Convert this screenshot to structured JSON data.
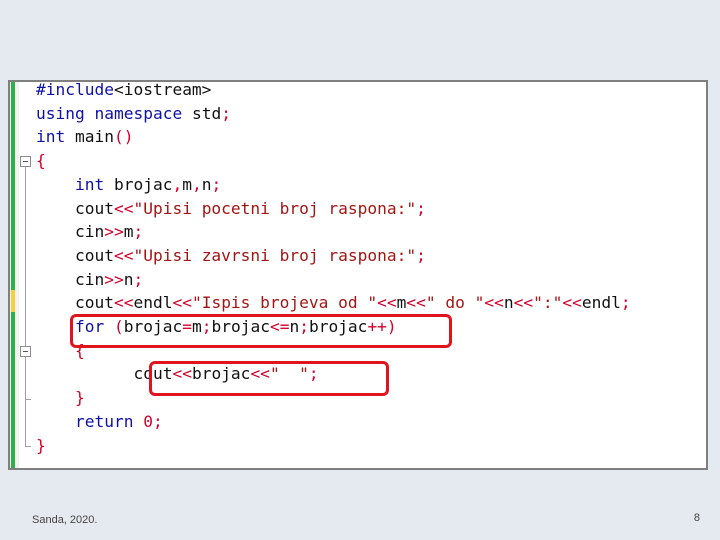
{
  "editor": {
    "lines": [
      [
        {
          "t": "#include",
          "c": "pp"
        },
        {
          "t": "<iostream>",
          "c": "tx"
        }
      ],
      [
        {
          "t": "using",
          "c": "kw"
        },
        {
          "t": " ",
          "c": "tx"
        },
        {
          "t": "namespace",
          "c": "kw"
        },
        {
          "t": " std",
          "c": "tx"
        },
        {
          "t": ";",
          "c": "op"
        }
      ],
      [
        {
          "t": "int",
          "c": "kw"
        },
        {
          "t": " main",
          "c": "tx"
        },
        {
          "t": "()",
          "c": "op"
        }
      ],
      [
        {
          "t": "{",
          "c": "op"
        }
      ],
      [
        {
          "t": "    ",
          "c": "tx"
        },
        {
          "t": "int",
          "c": "kw"
        },
        {
          "t": " brojac",
          "c": "tx"
        },
        {
          "t": ",",
          "c": "op"
        },
        {
          "t": "m",
          "c": "tx"
        },
        {
          "t": ",",
          "c": "op"
        },
        {
          "t": "n",
          "c": "tx"
        },
        {
          "t": ";",
          "c": "op"
        }
      ],
      [
        {
          "t": "    cout",
          "c": "tx"
        },
        {
          "t": "<<",
          "c": "op"
        },
        {
          "t": "\"Upisi pocetni broj raspona:\"",
          "c": "st"
        },
        {
          "t": ";",
          "c": "op"
        }
      ],
      [
        {
          "t": "    cin",
          "c": "tx"
        },
        {
          "t": ">>",
          "c": "op"
        },
        {
          "t": "m",
          "c": "tx"
        },
        {
          "t": ";",
          "c": "op"
        }
      ],
      [
        {
          "t": "    cout",
          "c": "tx"
        },
        {
          "t": "<<",
          "c": "op"
        },
        {
          "t": "\"Upisi zavrsni broj raspona:\"",
          "c": "st"
        },
        {
          "t": ";",
          "c": "op"
        }
      ],
      [
        {
          "t": "    cin",
          "c": "tx"
        },
        {
          "t": ">>",
          "c": "op"
        },
        {
          "t": "n",
          "c": "tx"
        },
        {
          "t": ";",
          "c": "op"
        }
      ],
      [
        {
          "t": "    cout",
          "c": "tx"
        },
        {
          "t": "<<",
          "c": "op"
        },
        {
          "t": "endl",
          "c": "tx"
        },
        {
          "t": "<<",
          "c": "op"
        },
        {
          "t": "\"Ispis brojeva od \"",
          "c": "st"
        },
        {
          "t": "<<",
          "c": "op"
        },
        {
          "t": "m",
          "c": "tx"
        },
        {
          "t": "<<",
          "c": "op"
        },
        {
          "t": "\" do \"",
          "c": "st"
        },
        {
          "t": "<<",
          "c": "op"
        },
        {
          "t": "n",
          "c": "tx"
        },
        {
          "t": "<<",
          "c": "op"
        },
        {
          "t": "\":\"",
          "c": "st"
        },
        {
          "t": "<<",
          "c": "op"
        },
        {
          "t": "endl",
          "c": "tx"
        },
        {
          "t": ";",
          "c": "op"
        }
      ],
      [
        {
          "t": "    ",
          "c": "tx"
        },
        {
          "t": "for",
          "c": "kw"
        },
        {
          "t": " ",
          "c": "tx"
        },
        {
          "t": "(",
          "c": "op"
        },
        {
          "t": "brojac",
          "c": "tx"
        },
        {
          "t": "=",
          "c": "op"
        },
        {
          "t": "m",
          "c": "tx"
        },
        {
          "t": ";",
          "c": "op"
        },
        {
          "t": "brojac",
          "c": "tx"
        },
        {
          "t": "<=",
          "c": "op"
        },
        {
          "t": "n",
          "c": "tx"
        },
        {
          "t": ";",
          "c": "op"
        },
        {
          "t": "brojac",
          "c": "tx"
        },
        {
          "t": "++)",
          "c": "op"
        }
      ],
      [
        {
          "t": "    ",
          "c": "tx"
        },
        {
          "t": "{",
          "c": "op"
        }
      ],
      [
        {
          "t": "          cout",
          "c": "tx"
        },
        {
          "t": "<<",
          "c": "op"
        },
        {
          "t": "brojac",
          "c": "tx"
        },
        {
          "t": "<<",
          "c": "op"
        },
        {
          "t": "\"  \"",
          "c": "st"
        },
        {
          "t": ";",
          "c": "op"
        }
      ],
      [
        {
          "t": "    ",
          "c": "tx"
        },
        {
          "t": "}",
          "c": "op"
        }
      ],
      [
        {
          "t": "    ",
          "c": "tx"
        },
        {
          "t": "return",
          "c": "kw"
        },
        {
          "t": " ",
          "c": "tx"
        },
        {
          "t": "0",
          "c": "op"
        },
        {
          "t": ";",
          "c": "op"
        }
      ],
      [
        {
          "t": "}",
          "c": "op"
        }
      ]
    ]
  },
  "footer": {
    "author": "Sanda, 2020.",
    "page_number": "8"
  },
  "colors": {
    "highlight_border": "#e0141e",
    "keyword": "#1010a8",
    "string": "#a31515",
    "operator": "#d4002a"
  }
}
